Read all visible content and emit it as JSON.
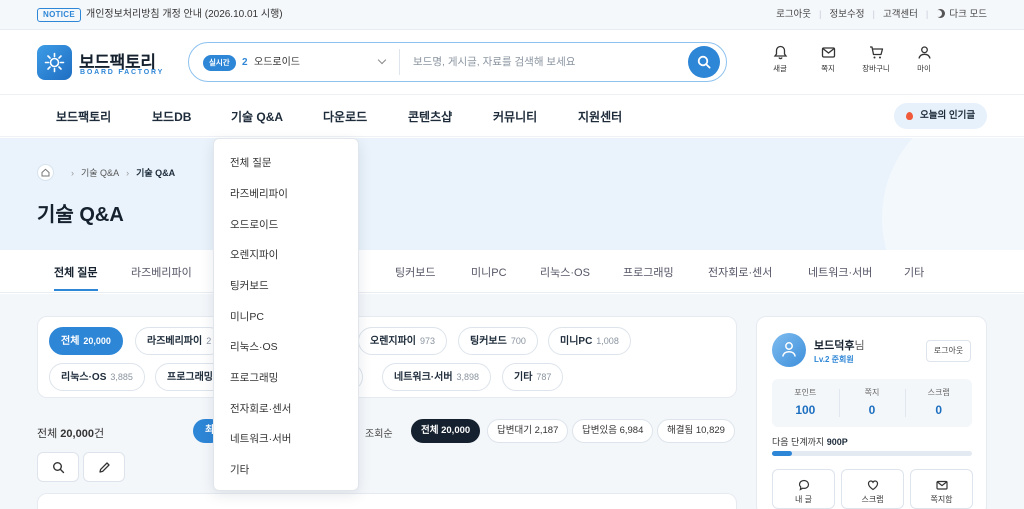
{
  "topbar": {
    "notice_badge": "NOTICE",
    "notice_text": "개인정보처리방침 개정 안내 (2026.10.01 시행)",
    "links": [
      "로그아웃",
      "정보수정",
      "고객센터"
    ],
    "dark_mode": "다크 모드"
  },
  "header": {
    "logo_title": "보드팩토리",
    "logo_sub": "BOARD FACTORY",
    "search": {
      "realtime_badge": "실시간",
      "realtime_rank": "2",
      "realtime_word": "오드로이드",
      "placeholder": "보드명, 게시글, 자료를 검색해 보세요"
    },
    "icons": [
      {
        "label": "새글",
        "icon": "bell-icon"
      },
      {
        "label": "쪽지",
        "icon": "mail-icon"
      },
      {
        "label": "장바구니",
        "icon": "cart-icon"
      },
      {
        "label": "마이",
        "icon": "user-icon"
      }
    ]
  },
  "gnb": {
    "items": [
      "보드팩토리",
      "보드DB",
      "기술 Q&A",
      "다운로드",
      "콘텐츠샵",
      "커뮤니티",
      "지원센터"
    ],
    "popular": "오늘의 인기글"
  },
  "hero": {
    "breadcrumb": [
      "기술 Q&A",
      "기술 Q&A"
    ],
    "title": "기술 Q&A"
  },
  "tabs": [
    "전체 질문",
    "라즈베리파이",
    "",
    "",
    "팅커보드",
    "미니PC",
    "리눅스·OS",
    "프로그래밍",
    "전자회로·센서",
    "네트워크·서버",
    "기타"
  ],
  "tab_partial": "l",
  "categories": [
    {
      "label": "전체",
      "count": "20,000"
    },
    {
      "label": "라즈베리파이",
      "count": "2"
    },
    {
      "label": "오렌지파이",
      "count": "973"
    },
    {
      "label": "팅커보드",
      "count": "700"
    },
    {
      "label": "미니PC",
      "count": "1,008"
    },
    {
      "label": "리눅스·OS",
      "count": "3,885"
    },
    {
      "label": "프로그래밍",
      "count": ""
    },
    {
      "label": "",
      "count": "8"
    },
    {
      "label": "네트워크·서버",
      "count": "3,898"
    },
    {
      "label": "기타",
      "count": "787"
    }
  ],
  "list": {
    "total_prefix": "전체 ",
    "total_count": "20,000",
    "total_suffix": "건",
    "sort_partial": "최",
    "sort_views": "조회순",
    "filters": [
      {
        "label": "전체 20,000"
      },
      {
        "label": "답변대기 2,187"
      },
      {
        "label": "답변있음 6,984"
      },
      {
        "label": "해결됨 10,829"
      }
    ]
  },
  "user": {
    "name": "보드덕후",
    "honorific": "님",
    "level": "Lv.2 준회원",
    "logout": "로그아웃",
    "stats": [
      {
        "label": "포인트",
        "value": "100"
      },
      {
        "label": "쪽지",
        "value": "0"
      },
      {
        "label": "스크랩",
        "value": "0"
      }
    ],
    "next_prefix": "다음 단계까지 ",
    "next_points": "900P",
    "progress": 0.1,
    "quick": [
      {
        "label": "내 글",
        "icon": "chat-icon"
      },
      {
        "label": "스크랩",
        "icon": "heart-icon"
      },
      {
        "label": "쪽지함",
        "icon": "mail-icon"
      }
    ]
  },
  "dropdown": {
    "items": [
      "전체 질문",
      "라즈베리파이",
      "오드로이드",
      "오렌지파이",
      "팅커보드",
      "미니PC",
      "리눅스·OS",
      "프로그래밍",
      "전자회로·센서",
      "네트워크·서버",
      "기타"
    ]
  },
  "colors": {
    "accent": "#2e86d6",
    "dark": "#15212e",
    "hero_bg": "#eaf3fb"
  }
}
